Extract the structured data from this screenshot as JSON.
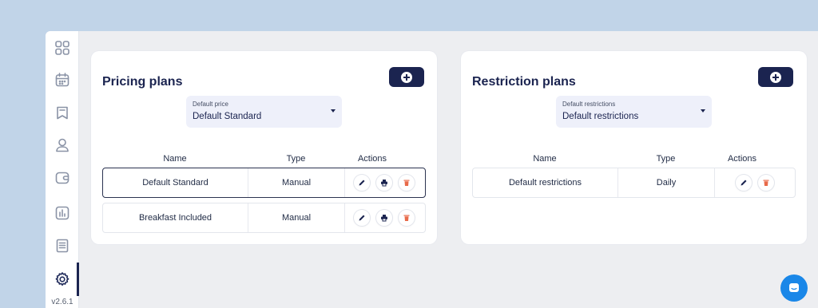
{
  "app": {
    "version": "v2.6.1"
  },
  "sidebar": {
    "items": [
      {
        "icon": "grid-icon",
        "active": false
      },
      {
        "icon": "calendar-icon",
        "active": false
      },
      {
        "icon": "bookmark-icon",
        "active": false
      },
      {
        "icon": "user-icon",
        "active": false
      },
      {
        "icon": "wallet-icon",
        "active": false
      },
      {
        "icon": "chart-icon",
        "active": false
      },
      {
        "icon": "document-icon",
        "active": false
      },
      {
        "icon": "gear-icon",
        "active": true
      }
    ]
  },
  "pricing": {
    "title": "Pricing plans",
    "select": {
      "label": "Default price",
      "value": "Default Standard"
    },
    "columns": [
      "Name",
      "Type",
      "Actions"
    ],
    "rows": [
      {
        "name": "Default Standard",
        "type": "Manual",
        "selected": true,
        "actions": [
          "edit-icon",
          "print-icon",
          "trash-icon"
        ]
      },
      {
        "name": "Breakfast Included",
        "type": "Manual",
        "selected": false,
        "actions": [
          "edit-icon",
          "print-icon",
          "trash-icon"
        ]
      }
    ]
  },
  "restriction": {
    "title": "Restriction plans",
    "select": {
      "label": "Default restrictions",
      "value": "Default restrictions"
    },
    "columns": [
      "Name",
      "Type",
      "Actions"
    ],
    "rows": [
      {
        "name": "Default restrictions",
        "type": "Daily",
        "selected": false,
        "actions": [
          "edit-icon",
          "trash-icon"
        ]
      }
    ]
  },
  "colors": {
    "primary": "#1b2450",
    "delete": "#e86a4a",
    "chat": "#1a87e8",
    "background": "#c1d4e8"
  }
}
